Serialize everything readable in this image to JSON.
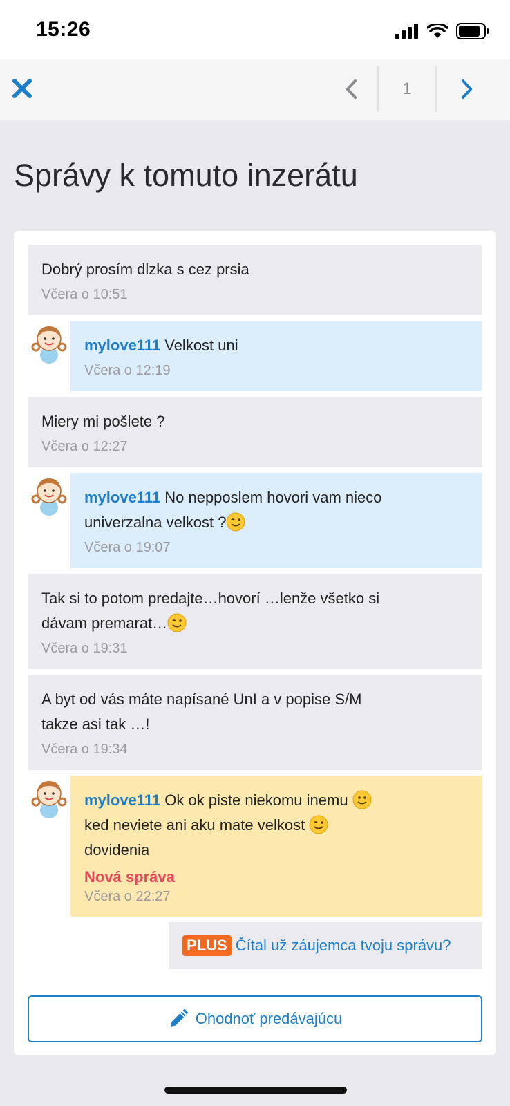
{
  "status_bar": {
    "time": "15:26"
  },
  "nav": {
    "page": "1"
  },
  "title": "Správy k tomuto inzerátu",
  "messages": [
    {
      "type": "in",
      "text": "Dobrý prosím dlzka s cez prsia",
      "time": "Včera o 10:51"
    },
    {
      "type": "out",
      "user": "mylove111",
      "text": "Velkost uni",
      "time": "Včera o 12:19"
    },
    {
      "type": "in",
      "text": "Miery mi pošlete ?",
      "time": "Včera o 12:27"
    },
    {
      "type": "out",
      "user": "mylove111",
      "text1": "No nepposlem hovori vam nieco",
      "text2": "univerzalna velkost ?",
      "time": "Včera o 19:07"
    },
    {
      "type": "in",
      "text1": "Tak si to potom predajte…hovorí …lenže všetko si",
      "text2": "dávam premarat…",
      "time": "Včera o 19:31"
    },
    {
      "type": "in",
      "text1": "A byt od vás máte napísané UnI a v popise S/M",
      "text2": "takze asi tak …!",
      "time": "Včera o 19:34"
    },
    {
      "type": "new",
      "user": "mylove111",
      "text1": "Ok ok piste niekomu inemu",
      "text2": "ked neviete ani aku mate velkost",
      "text3": "dovidenia",
      "new_label": "Nová správa",
      "time": "Včera o 22:27"
    }
  ],
  "plus": {
    "badge": "PLUS",
    "text": "Čítal už záujemca tvoju správu?"
  },
  "rate_button": {
    "label": "Ohodnoť predávajúcu"
  },
  "colors": {
    "accent": "#1e7fc8",
    "incoming": "#ebebef",
    "outgoing": "#dcedfc",
    "new_message": "#fde8ae",
    "plus_badge": "#f26a21",
    "new_label": "#e8485e"
  }
}
